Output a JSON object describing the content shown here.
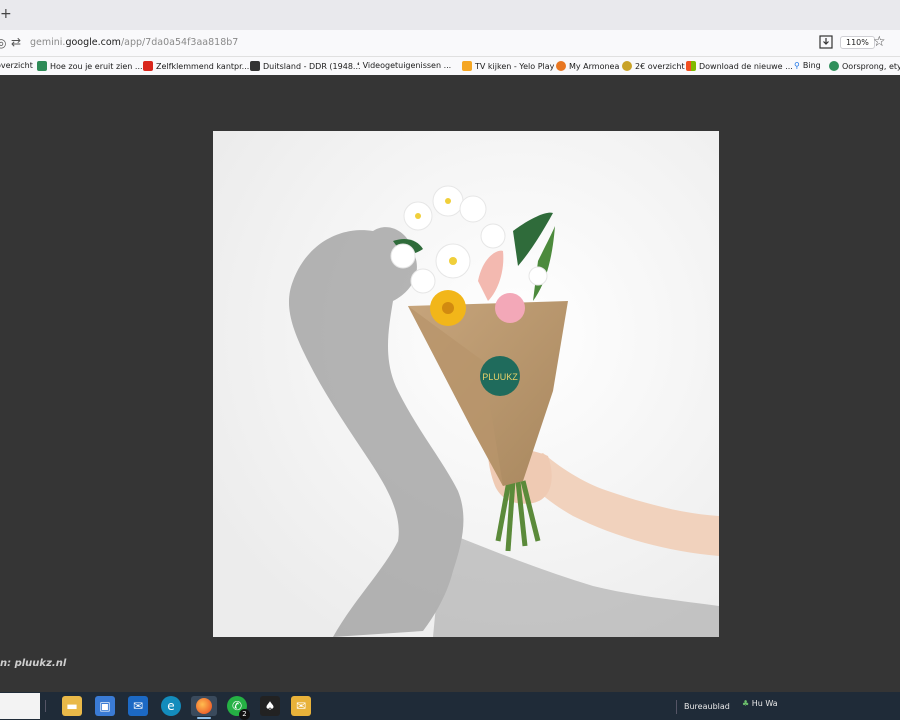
{
  "browser": {
    "new_tab": "+",
    "url_host_prefix": "gemini.",
    "url_host_domain": "google.com",
    "url_path": "/app/7da0a54f3aa818b7",
    "zoom": "110%"
  },
  "bookmarks": [
    {
      "label": "overzicht",
      "icon": "page-icon",
      "color": "#888888"
    },
    {
      "label": "Hoe zou je eruit zien ...",
      "icon": "green-figure-icon",
      "color": "#2e8b57"
    },
    {
      "label": "Zelfklemmend kantpr...",
      "icon": "red-tag-icon",
      "color": "#d9261c"
    },
    {
      "label": "Duitsland - DDR (1948...",
      "icon": "u-box-icon",
      "color": "#333333"
    },
    {
      "label": "Videogetuigenissen ...",
      "icon": "quote-icon",
      "color": "#333333"
    },
    {
      "label": "TV kijken - Yelo Play",
      "icon": "yelo-icon",
      "color": "#f5a623"
    },
    {
      "label": "My Armonea",
      "icon": "orange-badge-icon",
      "color": "#e87722"
    },
    {
      "label": "2€ overzicht",
      "icon": "coin-icon",
      "color": "#c9a227"
    },
    {
      "label": "Download de nieuwe ...",
      "icon": "windows-icon",
      "color": "#0078d4"
    },
    {
      "label": "Bing",
      "icon": "search-icon",
      "color": "#1a73e8"
    },
    {
      "label": "Oorsprong, etym",
      "icon": "green-circle-icon",
      "color": "#2f8f5b"
    }
  ],
  "photo": {
    "sticker_letters": [
      "P",
      "L",
      "U",
      "U",
      "K",
      "Z"
    ]
  },
  "caption": "n: pluukz.nl",
  "taskbar": {
    "whatsapp_badge": "2",
    "desktop_label": "Bureaublad",
    "user_label": "Hu Wa"
  }
}
